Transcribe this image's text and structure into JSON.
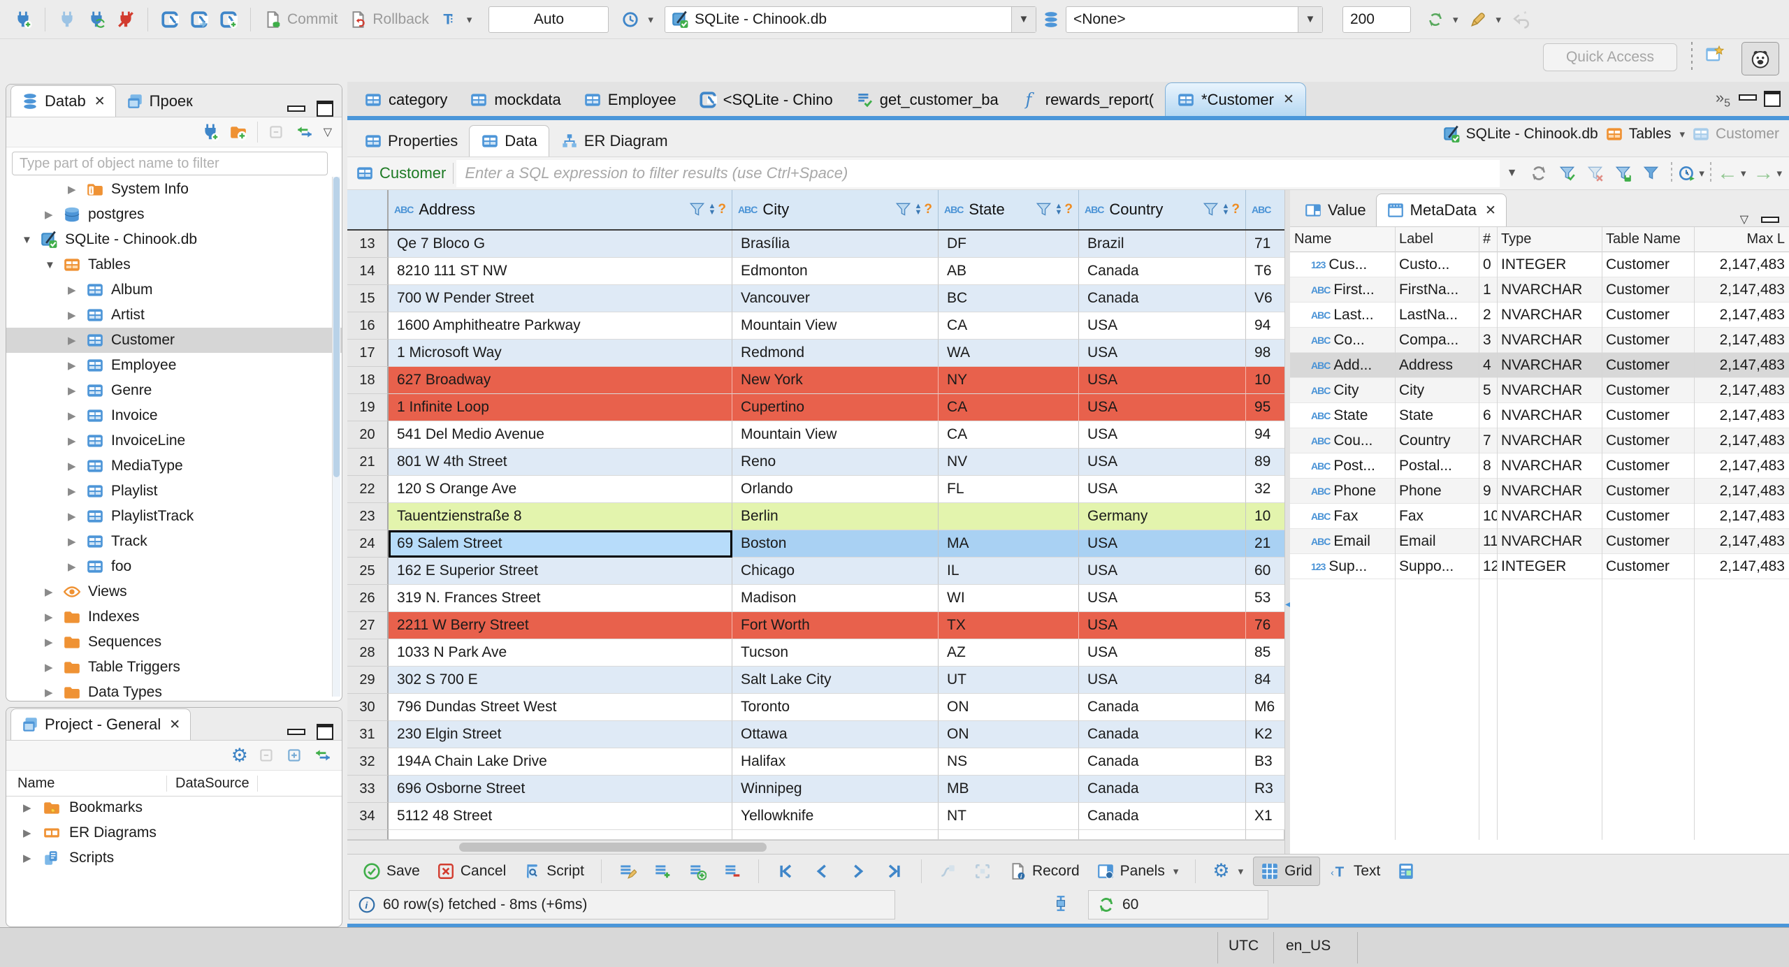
{
  "main_toolbar": {
    "commit_label": "Commit",
    "rollback_label": "Rollback",
    "tx_mode": "Auto",
    "connection": "SQLite - Chinook.db",
    "schema": "<None>",
    "fetch_size": "200",
    "quick_access_placeholder": "Quick Access"
  },
  "editor_tabs": {
    "tabs": [
      {
        "label": "category",
        "icon": "table-icon",
        "active": false
      },
      {
        "label": "mockdata",
        "icon": "table-icon",
        "active": false
      },
      {
        "label": "Employee",
        "icon": "table-icon",
        "active": false
      },
      {
        "label": "<SQLite - Chino",
        "icon": "sql-editor-icon",
        "active": false
      },
      {
        "label": "get_customer_ba",
        "icon": "script-check-icon",
        "active": false
      },
      {
        "label": "rewards_report(",
        "icon": "function-icon",
        "active": false
      },
      {
        "label": "*Customer",
        "icon": "table-icon",
        "active": true,
        "closable": true
      }
    ],
    "overflow_count": "5"
  },
  "navigator": {
    "tab_database": "Datab",
    "tab_projects": "Проек",
    "filter_placeholder": "Type part of object name to filter",
    "tree": [
      {
        "label": "System Info",
        "icon": "folder-info-icon",
        "indent": 2,
        "expanded": false,
        "selected": false
      },
      {
        "label": "postgres",
        "icon": "database-icon",
        "indent": 1,
        "expanded": false,
        "selected": false
      },
      {
        "label": "SQLite - Chinook.db",
        "icon": "sqlite-icon",
        "indent": 0,
        "expanded": true,
        "selected": false
      },
      {
        "label": "Tables",
        "icon": "folder-table-icon",
        "indent": 1,
        "expanded": true,
        "selected": false
      },
      {
        "label": "Album",
        "icon": "table-icon",
        "indent": 2,
        "expanded": false,
        "selected": false
      },
      {
        "label": "Artist",
        "icon": "table-icon",
        "indent": 2,
        "expanded": false,
        "selected": false
      },
      {
        "label": "Customer",
        "icon": "table-icon",
        "indent": 2,
        "expanded": false,
        "selected": true
      },
      {
        "label": "Employee",
        "icon": "table-icon",
        "indent": 2,
        "expanded": false,
        "selected": false
      },
      {
        "label": "Genre",
        "icon": "table-icon",
        "indent": 2,
        "expanded": false,
        "selected": false
      },
      {
        "label": "Invoice",
        "icon": "table-icon",
        "indent": 2,
        "expanded": false,
        "selected": false
      },
      {
        "label": "InvoiceLine",
        "icon": "table-icon",
        "indent": 2,
        "expanded": false,
        "selected": false
      },
      {
        "label": "MediaType",
        "icon": "table-icon",
        "indent": 2,
        "expanded": false,
        "selected": false
      },
      {
        "label": "Playlist",
        "icon": "table-icon",
        "indent": 2,
        "expanded": false,
        "selected": false
      },
      {
        "label": "PlaylistTrack",
        "icon": "table-icon",
        "indent": 2,
        "expanded": false,
        "selected": false
      },
      {
        "label": "Track",
        "icon": "table-icon",
        "indent": 2,
        "expanded": false,
        "selected": false
      },
      {
        "label": "foo",
        "icon": "table-icon",
        "indent": 2,
        "expanded": false,
        "selected": false
      },
      {
        "label": "Views",
        "icon": "eye-icon",
        "indent": 1,
        "expanded": false,
        "selected": false
      },
      {
        "label": "Indexes",
        "icon": "folder-icon",
        "indent": 1,
        "expanded": false,
        "selected": false
      },
      {
        "label": "Sequences",
        "icon": "folder-icon",
        "indent": 1,
        "expanded": false,
        "selected": false
      },
      {
        "label": "Table Triggers",
        "icon": "folder-icon",
        "indent": 1,
        "expanded": false,
        "selected": false
      },
      {
        "label": "Data Types",
        "icon": "folder-icon",
        "indent": 1,
        "expanded": false,
        "selected": false
      }
    ]
  },
  "project_panel": {
    "tab": "Project - General",
    "columns": [
      "Name",
      "DataSource"
    ],
    "tree": [
      {
        "label": "Bookmarks",
        "icon": "folder-bookmark-icon"
      },
      {
        "label": "ER Diagrams",
        "icon": "er-diagram-icon"
      },
      {
        "label": "Scripts",
        "icon": "scripts-icon"
      }
    ]
  },
  "editor": {
    "subtabs": [
      {
        "label": "Properties",
        "icon": "properties-icon",
        "active": false
      },
      {
        "label": "Data",
        "icon": "data-icon",
        "active": true
      },
      {
        "label": "ER Diagram",
        "icon": "er-icon",
        "active": false
      }
    ],
    "breadcrumb": [
      {
        "label": "SQLite - Chinook.db",
        "icon": "sqlite-icon",
        "dropdown": false
      },
      {
        "label": "Tables",
        "icon": "folder-table-icon",
        "dropdown": true
      },
      {
        "label": "Customer",
        "icon": "table-light-icon",
        "dropdown": false
      }
    ],
    "filter": {
      "entity": "Customer",
      "placeholder": "Enter a SQL expression to filter results (use Ctrl+Space)"
    }
  },
  "grid": {
    "columns": [
      "Address",
      "City",
      "State",
      "Country"
    ],
    "rows": [
      {
        "num": "13",
        "cells": [
          "Qe 7 Bloco G",
          "Brasília",
          "DF",
          "Brazil",
          "71"
        ],
        "style": "alt"
      },
      {
        "num": "14",
        "cells": [
          "8210 111 ST NW",
          "Edmonton",
          "AB",
          "Canada",
          "T6"
        ],
        "style": "plain"
      },
      {
        "num": "15",
        "cells": [
          "700 W Pender Street",
          "Vancouver",
          "BC",
          "Canada",
          "V6"
        ],
        "style": "alt"
      },
      {
        "num": "16",
        "cells": [
          "1600 Amphitheatre Parkway",
          "Mountain View",
          "CA",
          "USA",
          "94"
        ],
        "style": "plain"
      },
      {
        "num": "17",
        "cells": [
          "1 Microsoft Way",
          "Redmond",
          "WA",
          "USA",
          "98"
        ],
        "style": "alt"
      },
      {
        "num": "18",
        "cells": [
          "627 Broadway",
          "New York",
          "NY",
          "USA",
          "10"
        ],
        "style": "red"
      },
      {
        "num": "19",
        "cells": [
          "1 Infinite Loop",
          "Cupertino",
          "CA",
          "USA",
          "95"
        ],
        "style": "red"
      },
      {
        "num": "20",
        "cells": [
          "541 Del Medio Avenue",
          "Mountain View",
          "CA",
          "USA",
          "94"
        ],
        "style": "plain"
      },
      {
        "num": "21",
        "cells": [
          "801 W 4th Street",
          "Reno",
          "NV",
          "USA",
          "89"
        ],
        "style": "alt"
      },
      {
        "num": "22",
        "cells": [
          "120 S Orange Ave",
          "Orlando",
          "FL",
          "USA",
          "32"
        ],
        "style": "plain"
      },
      {
        "num": "23",
        "cells": [
          "Tauentzienstraße 8",
          "Berlin",
          "",
          "Germany",
          "10"
        ],
        "style": "green"
      },
      {
        "num": "24",
        "cells": [
          "69 Salem Street",
          "Boston",
          "MA",
          "USA",
          "21"
        ],
        "style": "selected",
        "focus_cell": 0
      },
      {
        "num": "25",
        "cells": [
          "162 E Superior Street",
          "Chicago",
          "IL",
          "USA",
          "60"
        ],
        "style": "alt"
      },
      {
        "num": "26",
        "cells": [
          "319 N. Frances Street",
          "Madison",
          "WI",
          "USA",
          "53"
        ],
        "style": "plain"
      },
      {
        "num": "27",
        "cells": [
          "2211 W Berry Street",
          "Fort Worth",
          "TX",
          "USA",
          "76"
        ],
        "style": "red"
      },
      {
        "num": "28",
        "cells": [
          "1033 N Park Ave",
          "Tucson",
          "AZ",
          "USA",
          "85"
        ],
        "style": "plain"
      },
      {
        "num": "29",
        "cells": [
          "302 S 700 E",
          "Salt Lake City",
          "UT",
          "USA",
          "84"
        ],
        "style": "alt"
      },
      {
        "num": "30",
        "cells": [
          "796 Dundas Street West",
          "Toronto",
          "ON",
          "Canada",
          "M6"
        ],
        "style": "plain"
      },
      {
        "num": "31",
        "cells": [
          "230 Elgin Street",
          "Ottawa",
          "ON",
          "Canada",
          "K2"
        ],
        "style": "alt"
      },
      {
        "num": "32",
        "cells": [
          "194A Chain Lake Drive",
          "Halifax",
          "NS",
          "Canada",
          "B3"
        ],
        "style": "plain"
      },
      {
        "num": "33",
        "cells": [
          "696 Osborne Street",
          "Winnipeg",
          "MB",
          "Canada",
          "R3"
        ],
        "style": "alt"
      },
      {
        "num": "34",
        "cells": [
          "5112 48 Street",
          "Yellowknife",
          "NT",
          "Canada",
          "X1"
        ],
        "style": "plain"
      }
    ]
  },
  "metadata": {
    "tab_value": "Value",
    "tab_metadata": "MetaData",
    "columns": [
      "Name",
      "Label",
      "#",
      "Type",
      "Table Name",
      "Max L"
    ],
    "rows": [
      {
        "type_icon": "123",
        "name": "Cus...",
        "label": "Custo...",
        "ordinal": "0",
        "type": "INTEGER",
        "table": "Customer",
        "max": "2,147,483",
        "selected": false
      },
      {
        "type_icon": "ABC",
        "name": "First...",
        "label": "FirstNa...",
        "ordinal": "1",
        "type": "NVARCHAR",
        "table": "Customer",
        "max": "2,147,483",
        "selected": false
      },
      {
        "type_icon": "ABC",
        "name": "Last...",
        "label": "LastNa...",
        "ordinal": "2",
        "type": "NVARCHAR",
        "table": "Customer",
        "max": "2,147,483",
        "selected": false
      },
      {
        "type_icon": "ABC",
        "name": "Co...",
        "label": "Compa...",
        "ordinal": "3",
        "type": "NVARCHAR",
        "table": "Customer",
        "max": "2,147,483",
        "selected": false
      },
      {
        "type_icon": "ABC",
        "name": "Add...",
        "label": "Address",
        "ordinal": "4",
        "type": "NVARCHAR",
        "table": "Customer",
        "max": "2,147,483",
        "selected": true
      },
      {
        "type_icon": "ABC",
        "name": "City",
        "label": "City",
        "ordinal": "5",
        "type": "NVARCHAR",
        "table": "Customer",
        "max": "2,147,483",
        "selected": false
      },
      {
        "type_icon": "ABC",
        "name": "State",
        "label": "State",
        "ordinal": "6",
        "type": "NVARCHAR",
        "table": "Customer",
        "max": "2,147,483",
        "selected": false
      },
      {
        "type_icon": "ABC",
        "name": "Cou...",
        "label": "Country",
        "ordinal": "7",
        "type": "NVARCHAR",
        "table": "Customer",
        "max": "2,147,483",
        "selected": false
      },
      {
        "type_icon": "ABC",
        "name": "Post...",
        "label": "Postal...",
        "ordinal": "8",
        "type": "NVARCHAR",
        "table": "Customer",
        "max": "2,147,483",
        "selected": false
      },
      {
        "type_icon": "ABC",
        "name": "Phone",
        "label": "Phone",
        "ordinal": "9",
        "type": "NVARCHAR",
        "table": "Customer",
        "max": "2,147,483",
        "selected": false
      },
      {
        "type_icon": "ABC",
        "name": "Fax",
        "label": "Fax",
        "ordinal": "10",
        "type": "NVARCHAR",
        "table": "Customer",
        "max": "2,147,483",
        "selected": false
      },
      {
        "type_icon": "ABC",
        "name": "Email",
        "label": "Email",
        "ordinal": "11",
        "type": "NVARCHAR",
        "table": "Customer",
        "max": "2,147,483",
        "selected": false
      },
      {
        "type_icon": "123",
        "name": "Sup...",
        "label": "Suppo...",
        "ordinal": "12",
        "type": "INTEGER",
        "table": "Customer",
        "max": "2,147,483",
        "selected": false
      }
    ]
  },
  "result_toolbar": {
    "save": "Save",
    "cancel": "Cancel",
    "script": "Script",
    "record": "Record",
    "panels": "Panels",
    "grid": "Grid",
    "text": "Text"
  },
  "result_status": {
    "message": "60 row(s) fetched - 8ms (+6ms)",
    "refresh_count": "60"
  },
  "statusbar": {
    "timezone": "UTC",
    "locale": "en_US"
  }
}
